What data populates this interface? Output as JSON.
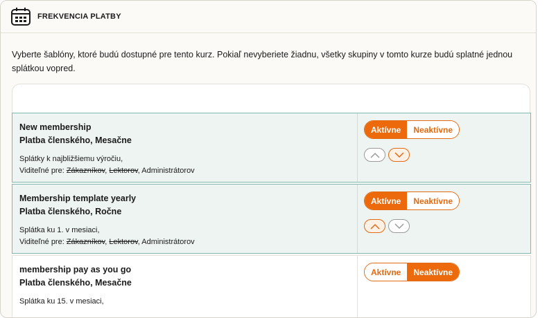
{
  "header": {
    "title": "FREKVENCIA PLATBY",
    "icon": "calendar-icon"
  },
  "description": "Vyberte šablóny, ktoré budú dostupné pre tento kurz. Pokiaľ nevyberiete žiadnu, všetky skupiny v tomto kurze budú splatné jednou splátkou vopred.",
  "colors": {
    "accent": "#ec6a0c",
    "active_row_bg": "#eef4f2",
    "active_row_border": "#7fbab2"
  },
  "templates": [
    {
      "name": "New membership",
      "subtitle": "Platba členského, Mesačne",
      "info": "Splátky k najbližšiemu výročiu,",
      "visible_prefix": "Viditeľné pre: ",
      "visible_strike_1": "Zákazníkov",
      "visible_sep": ", ",
      "visible_strike_2": "Lektorov",
      "visible_rest": ", Administrátorov",
      "active_label": "Aktívne",
      "inactive_label": "Neaktívne",
      "state": "active"
    },
    {
      "name": "Membership template yearly",
      "subtitle": "Platba členského, Ročne",
      "info": "Splátka ku 1. v mesiaci,",
      "visible_prefix": "Viditeľné pre: ",
      "visible_strike_1": "Zákazníkov",
      "visible_sep": ", ",
      "visible_strike_2": "Lektorov",
      "visible_rest": ", Administrátorov",
      "active_label": "Aktívne",
      "inactive_label": "Neaktívne",
      "state": "active"
    },
    {
      "name": "membership pay as you go",
      "subtitle": "Platba členského, Mesačne",
      "info": "Splátka ku 15. v mesiaci,",
      "active_label": "Aktívne",
      "inactive_label": "Neaktívne",
      "state": "inactive"
    }
  ]
}
